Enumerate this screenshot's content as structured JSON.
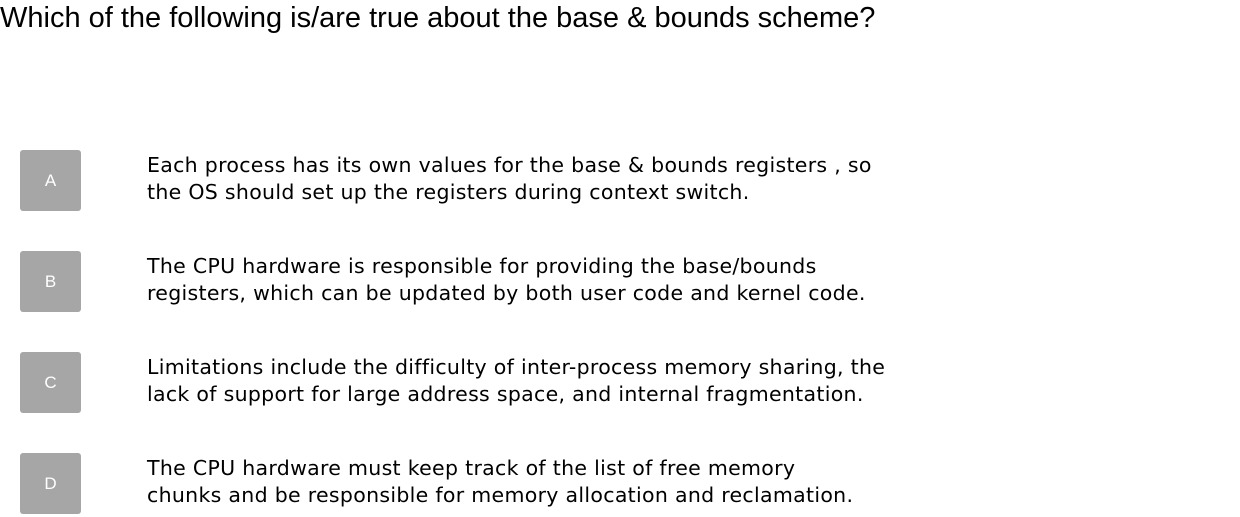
{
  "question": "Which of the following is/are true about the base & bounds scheme?",
  "options": [
    {
      "letter": "A",
      "lines": [
        "Each process has its own values for the base & bounds registers , so",
        "the OS should set up the registers during context switch."
      ]
    },
    {
      "letter": "B",
      "lines": [
        "The CPU hardware is responsible for providing the base/bounds",
        "registers, which can be updated by both user code and kernel code."
      ]
    },
    {
      "letter": "C",
      "lines": [
        "Limitations include the difficulty of inter-process memory sharing, the",
        "lack of support for large address space, and internal fragmentation."
      ]
    },
    {
      "letter": "D",
      "lines": [
        "The CPU hardware must keep track of the list of free memory",
        "chunks and be responsible for memory allocation and reclamation."
      ]
    }
  ],
  "colors": {
    "badge_bg": "#a6a6a6",
    "badge_text": "#ffffff",
    "text": "#000000"
  }
}
